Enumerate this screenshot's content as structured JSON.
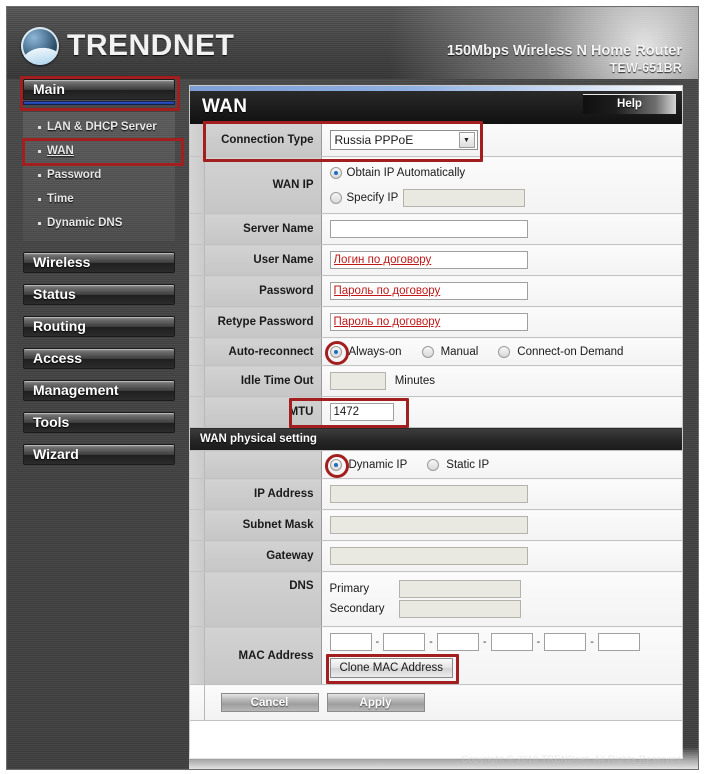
{
  "header": {
    "brand": "TRENDNET",
    "product_line1": "150Mbps Wireless N Home Router",
    "product_model": "TEW-651BR"
  },
  "sidebar": {
    "main_label": "Main",
    "submenu": [
      {
        "label": "LAN & DHCP Server",
        "active": false
      },
      {
        "label": "WAN",
        "active": true
      },
      {
        "label": "Password",
        "active": false
      },
      {
        "label": "Time",
        "active": false
      },
      {
        "label": "Dynamic DNS",
        "active": false
      }
    ],
    "buttons": [
      "Wireless",
      "Status",
      "Routing",
      "Access",
      "Management",
      "Tools",
      "Wizard"
    ]
  },
  "content": {
    "page_title": "WAN",
    "help_label": "Help",
    "connection_type": {
      "label": "Connection Type",
      "value": "Russia PPPoE"
    },
    "wan_ip": {
      "label": "WAN IP",
      "option_auto": "Obtain IP Automatically",
      "option_specify": "Specify IP",
      "selected": "auto",
      "specify_value": ""
    },
    "server_name": {
      "label": "Server Name",
      "value": ""
    },
    "user_name": {
      "label": "User Name",
      "value": "Логин по договору"
    },
    "password": {
      "label": "Password",
      "value": "Пароль по договору"
    },
    "retype_password": {
      "label": "Retype Password",
      "value": "Пароль по договору"
    },
    "auto_reconnect": {
      "label": "Auto-reconnect",
      "options": [
        "Always-on",
        "Manual",
        "Connect-on Demand"
      ],
      "selected": "Always-on"
    },
    "idle_timeout": {
      "label": "Idle Time Out",
      "value": "",
      "unit": "Minutes"
    },
    "mtu": {
      "label": "MTU",
      "value": "1472"
    },
    "physical_section": {
      "title": "WAN physical setting",
      "options": [
        "Dynamic IP",
        "Static IP"
      ],
      "selected": "Dynamic IP",
      "ip_address": {
        "label": "IP Address",
        "value": ""
      },
      "subnet_mask": {
        "label": "Subnet Mask",
        "value": ""
      },
      "gateway": {
        "label": "Gateway",
        "value": ""
      },
      "dns": {
        "label": "DNS",
        "primary_caption": "Primary",
        "primary_value": "",
        "secondary_caption": "Secondary",
        "secondary_value": ""
      },
      "mac_address": {
        "label": "MAC Address",
        "octets": [
          "",
          "",
          "",
          "",
          "",
          ""
        ],
        "separator": "-",
        "clone_button": "Clone MAC Address"
      }
    },
    "footer": {
      "cancel_label": "Cancel",
      "apply_label": "Apply"
    }
  },
  "copyright": "Copyright © 2010 TRENDnet. All Rights Reserved.",
  "colors": {
    "accent_blue": "#2e56c8",
    "annotation_red": "#a31f1f",
    "value_red": "#c01818"
  }
}
